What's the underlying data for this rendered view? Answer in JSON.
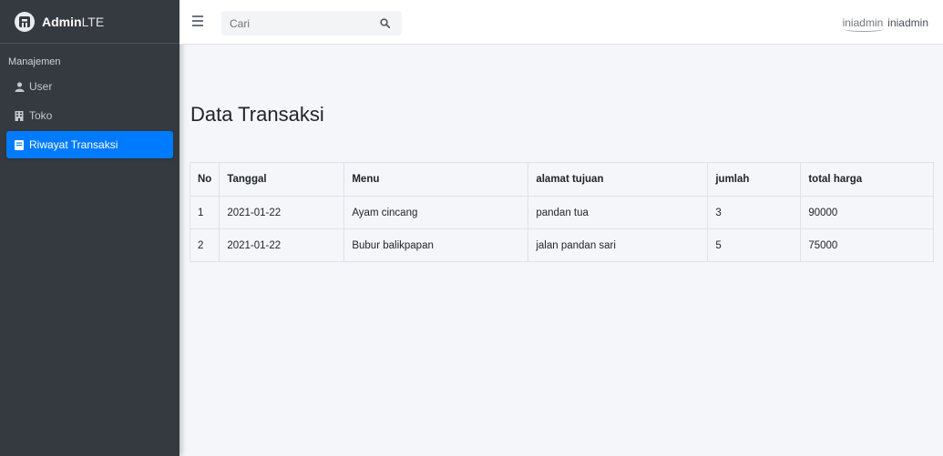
{
  "brand": {
    "name_bold": "Admin",
    "name_light": "LTE"
  },
  "sidebar": {
    "header": "Manajemen",
    "items": [
      {
        "label": "User",
        "icon": "user-icon",
        "active": false
      },
      {
        "label": "Toko",
        "icon": "building-icon",
        "active": false
      },
      {
        "label": "Riwayat Transaksi",
        "icon": "book-icon",
        "active": true
      }
    ]
  },
  "topbar": {
    "search_placeholder": "Cari",
    "user_avatar_alt": "iniadmin",
    "user_name": "iniadmin"
  },
  "main": {
    "title": "Data Transaksi",
    "table": {
      "columns": [
        "No",
        "Tanggal",
        "Menu",
        "alamat tujuan",
        "jumlah",
        "total harga"
      ],
      "rows": [
        [
          "1",
          "2021-01-22",
          "Ayam cincang",
          "pandan tua",
          "3",
          "90000"
        ],
        [
          "2",
          "2021-01-22",
          "Bubur balikpapan",
          "jalan pandan sari",
          "5",
          "75000"
        ]
      ]
    }
  },
  "colors": {
    "sidebar_bg": "#343a40",
    "active": "#007bff",
    "content_bg": "#f4f6f9"
  }
}
